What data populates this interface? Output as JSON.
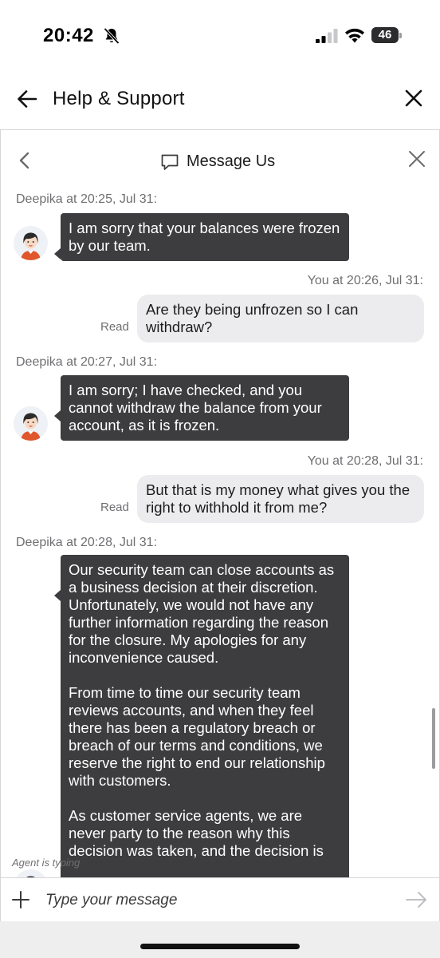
{
  "status_bar": {
    "time": "20:42",
    "battery_level": "46",
    "icons": [
      "bell-slash-icon",
      "signal-icon",
      "wifi-icon",
      "battery-icon"
    ]
  },
  "header": {
    "title": "Help & Support",
    "back_icon": "arrow-left-icon",
    "close_icon": "close-icon"
  },
  "panel": {
    "title": "Message Us",
    "back_icon": "chevron-left-icon",
    "title_icon": "message-bubble-icon",
    "close_icon": "close-icon"
  },
  "messages": [
    {
      "from": "agent",
      "meta": "Deepika at 20:25, Jul 31:",
      "text": "I am sorry that your balances were frozen by our team."
    },
    {
      "from": "user",
      "meta": "You at 20:26, Jul 31:",
      "text": "Are they being unfrozen so I can withdraw?",
      "status": "Read"
    },
    {
      "from": "agent",
      "meta": "Deepika at 20:27, Jul 31:",
      "text": "I am sorry; I have checked, and you cannot withdraw the balance from your account, as it is frozen."
    },
    {
      "from": "user",
      "meta": "You at 20:28, Jul 31:",
      "text": "But that is my money what gives you the right to withhold it from me?",
      "status": "Read"
    },
    {
      "from": "agent",
      "meta": "Deepika at 20:28, Jul 31:",
      "text": "Our security team can close accounts as a business decision at their discretion. Unfortunately, we would not have any further information regarding the reason for the closure. My apologies for any inconvenience caused.\n\nFrom time to time our security team reviews accounts, and when they feel there has been a regulatory breach or breach of our terms and conditions, we reserve the right to end our relationship with customers.\n\nAs customer service agents, we are never party to the reason why this decision was taken, and the decision is"
    }
  ],
  "typing_indicator": "Agent is typing",
  "composer": {
    "placeholder": "Type your message",
    "add_icon": "plus-icon",
    "send_icon": "send-arrow-icon"
  },
  "colors": {
    "agent_bubble": "#3d3d3f",
    "user_bubble": "#ececee",
    "meta_text": "#6f6f73",
    "avatar_accent": "#e0562d"
  }
}
